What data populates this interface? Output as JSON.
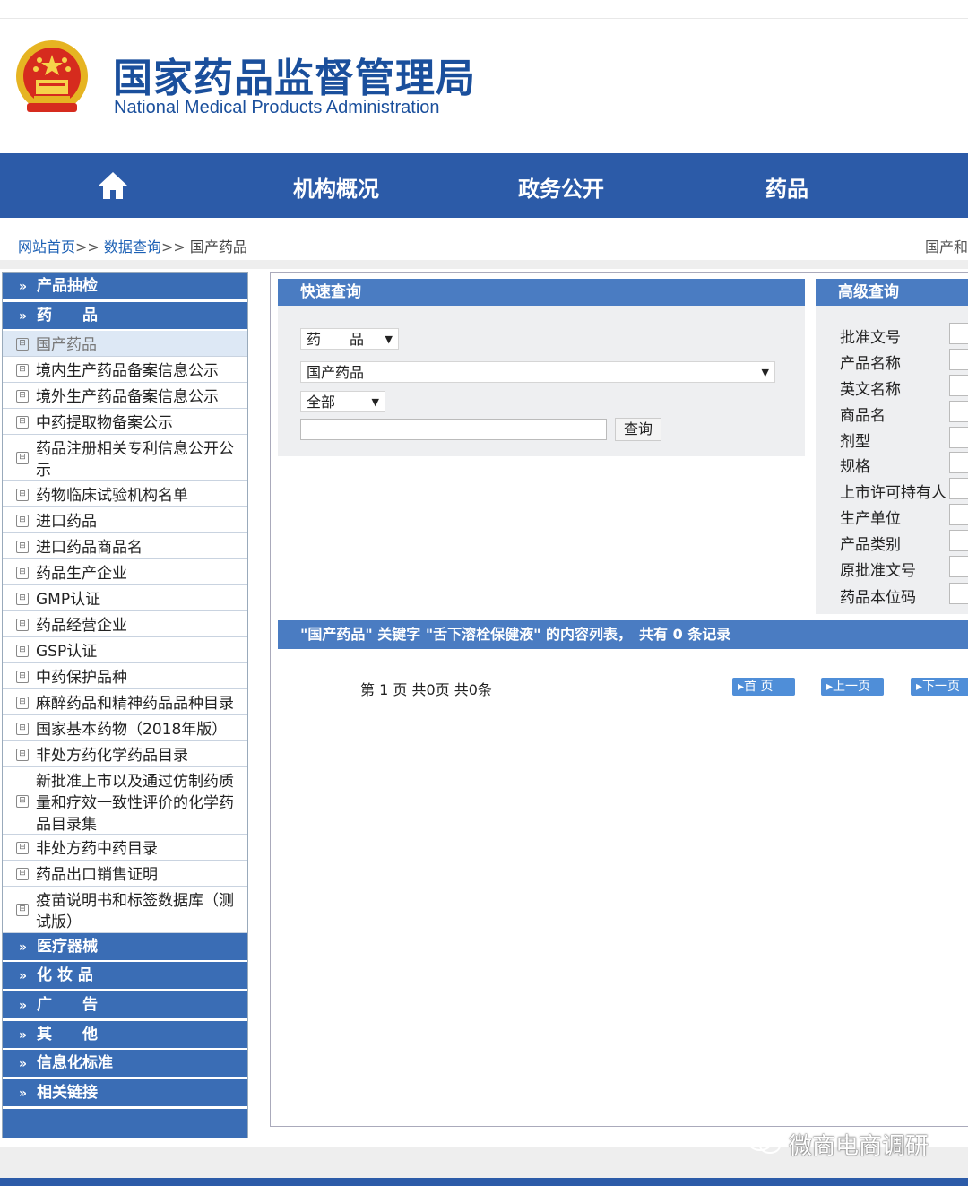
{
  "header": {
    "title_cn": "国家药品监督管理局",
    "title_en": "National Medical Products Administration"
  },
  "nav": {
    "items": [
      {
        "label": "机构概况"
      },
      {
        "label": "政务公开"
      },
      {
        "label": "药品"
      }
    ]
  },
  "breadcrumb": {
    "home": "网站首页",
    "sep": ">>",
    "data_query": "数据查询",
    "current": "国产药品",
    "right_text": "国产和"
  },
  "sidebar": {
    "categories": [
      {
        "label": "产品抽检"
      },
      {
        "label": "药　　品"
      },
      {
        "label": "医疗器械"
      },
      {
        "label": "化 妆 品"
      },
      {
        "label": "广　　告"
      },
      {
        "label": "其　　他"
      },
      {
        "label": "信息化标准"
      },
      {
        "label": "相关链接"
      }
    ],
    "items": [
      {
        "label": "国产药品"
      },
      {
        "label": "境内生产药品备案信息公示"
      },
      {
        "label": "境外生产药品备案信息公示"
      },
      {
        "label": "中药提取物备案公示"
      },
      {
        "label": "药品注册相关专利信息公开公示"
      },
      {
        "label": "药物临床试验机构名单"
      },
      {
        "label": "进口药品"
      },
      {
        "label": "进口药品商品名"
      },
      {
        "label": "药品生产企业"
      },
      {
        "label": "GMP认证"
      },
      {
        "label": "药品经营企业"
      },
      {
        "label": "GSP认证"
      },
      {
        "label": "中药保护品种"
      },
      {
        "label": "麻醉药品和精神药品品种目录"
      },
      {
        "label": "国家基本药物（2018年版）"
      },
      {
        "label": "非处方药化学药品目录"
      },
      {
        "label": "新批准上市以及通过仿制药质量和疗效一致性评价的化学药品目录集"
      },
      {
        "label": "非处方药中药目录"
      },
      {
        "label": "药品出口销售证明"
      },
      {
        "label": "疫苗说明书和标签数据库（测试版）"
      }
    ]
  },
  "quick": {
    "title": "快速查询",
    "category_select": "药　　品",
    "subcategory_select": "国产药品",
    "scope_select": "全部",
    "keyword_value": "",
    "query_button": "查询"
  },
  "advanced": {
    "title": "高级查询",
    "fields": [
      {
        "label": "批准文号"
      },
      {
        "label": "产品名称"
      },
      {
        "label": "英文名称"
      },
      {
        "label": "商品名"
      },
      {
        "label": "剂型"
      },
      {
        "label": "规格"
      },
      {
        "label": "上市许可持有人"
      },
      {
        "label": "生产单位"
      },
      {
        "label": "产品类别"
      },
      {
        "label": "原批准文号"
      },
      {
        "label": "药品本位码"
      }
    ]
  },
  "results": {
    "summary": "\"国产药品\" 关键字 \"舌下溶栓保健液\" 的内容列表，　共有 0 条记录",
    "pagination": {
      "info": "第 1 页 共0页 共0条",
      "first": "首 页",
      "prev": "上一页",
      "next": "下一页"
    }
  },
  "watermark": {
    "label": "微商电商调研"
  }
}
